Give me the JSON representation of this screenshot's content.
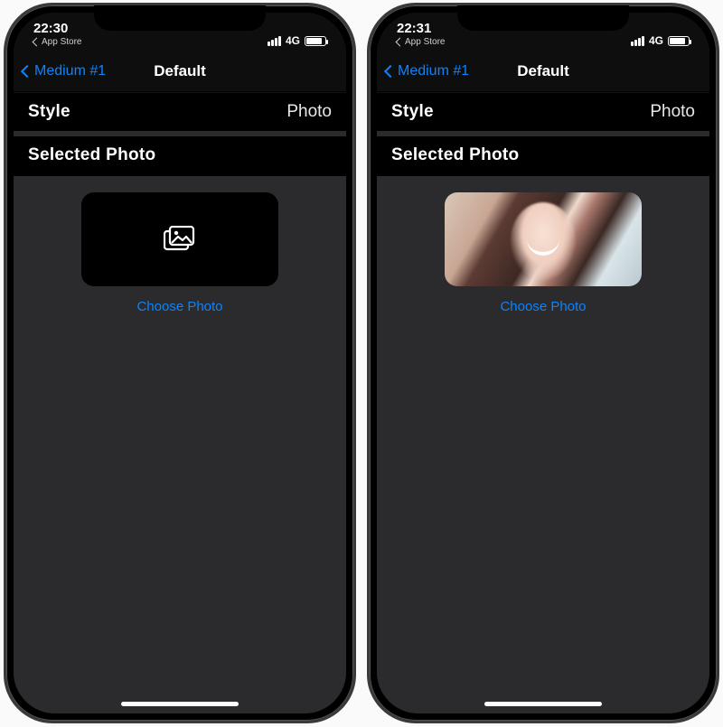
{
  "phones": [
    {
      "status": {
        "time": "22:30",
        "breadcrumb": "App Store",
        "network": "4G"
      },
      "nav": {
        "back_label": "Medium #1",
        "title": "Default"
      },
      "style_row": {
        "label": "Style",
        "value": "Photo"
      },
      "photo_section": {
        "header": "Selected Photo",
        "has_photo": false,
        "choose_label": "Choose Photo"
      }
    },
    {
      "status": {
        "time": "22:31",
        "breadcrumb": "App Store",
        "network": "4G"
      },
      "nav": {
        "back_label": "Medium #1",
        "title": "Default"
      },
      "style_row": {
        "label": "Style",
        "value": "Photo"
      },
      "photo_section": {
        "header": "Selected Photo",
        "has_photo": true,
        "choose_label": "Choose Photo"
      }
    }
  ]
}
